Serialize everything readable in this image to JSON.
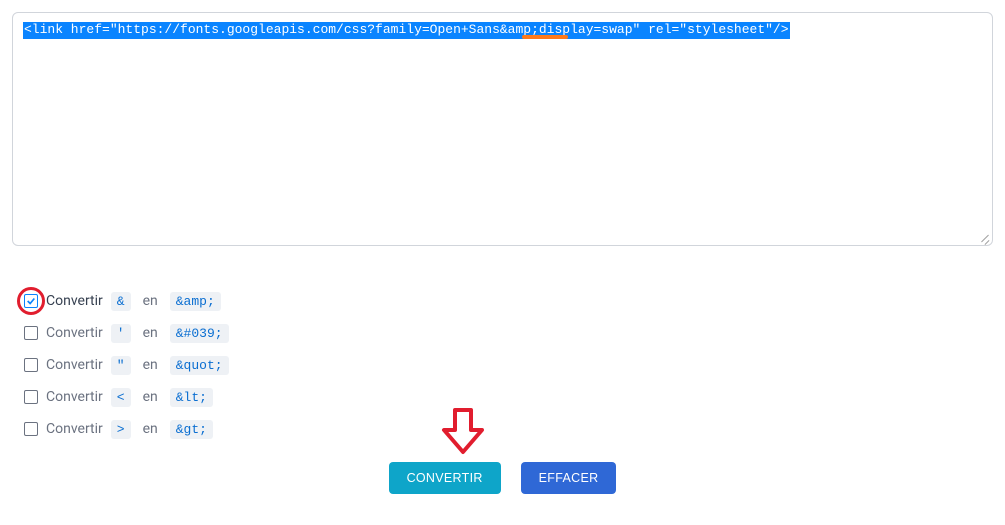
{
  "textarea": {
    "code": "<link href=\"https://fonts.googleapis.com/css?family=Open+Sans&amp;display=swap\" rel=\"stylesheet\"/>"
  },
  "options": [
    {
      "label": "Convertir",
      "from": "&",
      "mid": "en",
      "to": "&amp;",
      "checked": true
    },
    {
      "label": "Convertir",
      "from": "'",
      "mid": "en",
      "to": "&#039;",
      "checked": false
    },
    {
      "label": "Convertir",
      "from": "\"",
      "mid": "en",
      "to": "&quot;",
      "checked": false
    },
    {
      "label": "Convertir",
      "from": "<",
      "mid": "en",
      "to": "&lt;",
      "checked": false
    },
    {
      "label": "Convertir",
      "from": ">",
      "mid": "en",
      "to": "&gt;",
      "checked": false
    }
  ],
  "buttons": {
    "convert": "CONVERTIR",
    "clear": "EFFACER"
  }
}
